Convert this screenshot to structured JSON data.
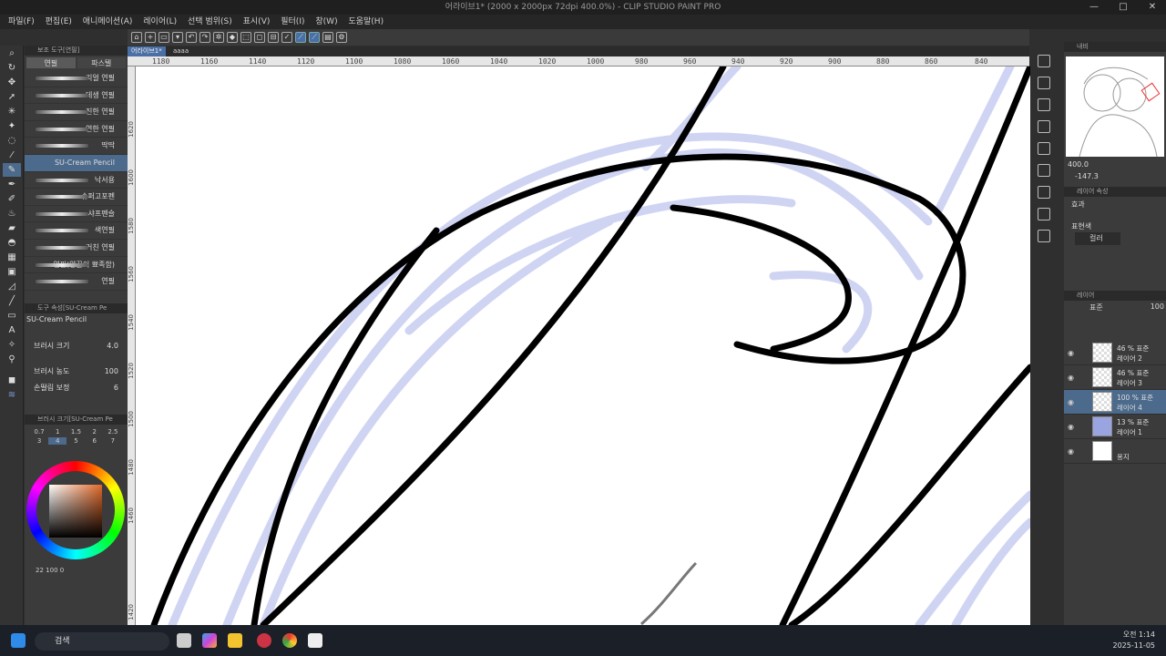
{
  "window": {
    "title": "어라이브1* (2000 x 2000px 72dpi 400.0%)  - CLIP STUDIO PAINT PRO",
    "minimize": "—",
    "maximize": "□",
    "close": "✕"
  },
  "menu": [
    "파일(F)",
    "편집(E)",
    "애니메이션(A)",
    "레이어(L)",
    "선택 범위(S)",
    "표시(V)",
    "필터(I)",
    "창(W)",
    "도움말(H)"
  ],
  "doc_tabs": [
    "어라이브1*",
    "aaaa"
  ],
  "subtool_panel": {
    "header": "보조 도구[연필]",
    "tab_pencil": "연필",
    "tab_pastel": "파스텔",
    "brushes": [
      "리얼 연필",
      "데생 연필",
      "진한 연필",
      "연한 연필",
      "딱딱",
      "SU-Cream Pencil",
      "낙서용",
      "슈퍼고포펜",
      "샤프펜슬",
      "색연필",
      "거친 연필",
      "연필(양끝이 뾰족함)",
      "연필"
    ],
    "selected_brush": "SU-Cream Pencil"
  },
  "tool_property": {
    "header": "도구 속성[SU-Cream Pe",
    "brush_name": "SU-Cream Pencil",
    "brush_size_label": "브러시 크기",
    "brush_size": "4.0",
    "density_label": "브러시 농도",
    "density": "100",
    "stabilize_label": "손떨림 보정",
    "stabilize": "6"
  },
  "brush_size_palette": {
    "header": "브러시 크기[SU-Cream Pe",
    "sizes": [
      "0.7",
      "1",
      "1.5",
      "2",
      "2.5",
      "3",
      "4",
      "5",
      "6",
      "7"
    ],
    "selected": "4"
  },
  "color": {
    "hue_ring": "color-wheel",
    "r_value": "22",
    "g_value": "100",
    "b_value": "0",
    "main": "#000000",
    "sub": "#ffffff"
  },
  "ruler_top": [
    "1180",
    "1160",
    "1140",
    "1120",
    "1100",
    "1080",
    "1060",
    "1040",
    "1020",
    "1000",
    "980",
    "960",
    "940",
    "920",
    "900",
    "880",
    "860",
    "840"
  ],
  "ruler_left": [
    "1620",
    "1600",
    "1580",
    "1560",
    "1540",
    "1520",
    "1500",
    "1480",
    "1460",
    "1420"
  ],
  "navigator": {
    "header": "내비",
    "zoom": "400.0",
    "rotation": "-147.3"
  },
  "layer_property": {
    "header": "레이어 속성",
    "effect_label": "효과",
    "expression_label": "표현색",
    "expression_value": "컬러"
  },
  "layers_panel": {
    "header": "레이어",
    "blend": "표준",
    "opacity": "100",
    "layers": [
      {
        "line1": "46 % 표준",
        "line2": "레이어 2",
        "selected": false
      },
      {
        "line1": "46 % 표준",
        "line2": "레이어 3",
        "selected": false
      },
      {
        "line1": "100 % 표준",
        "line2": "레이어 4",
        "selected": true
      },
      {
        "line1": "13 % 표준",
        "line2": "레이어 1",
        "selected": false
      },
      {
        "line1": "",
        "line2": "용지",
        "selected": false
      }
    ]
  },
  "taskbar": {
    "search_placeholder": "검색",
    "time": "오전 1:14",
    "date": "2025-11-05"
  }
}
